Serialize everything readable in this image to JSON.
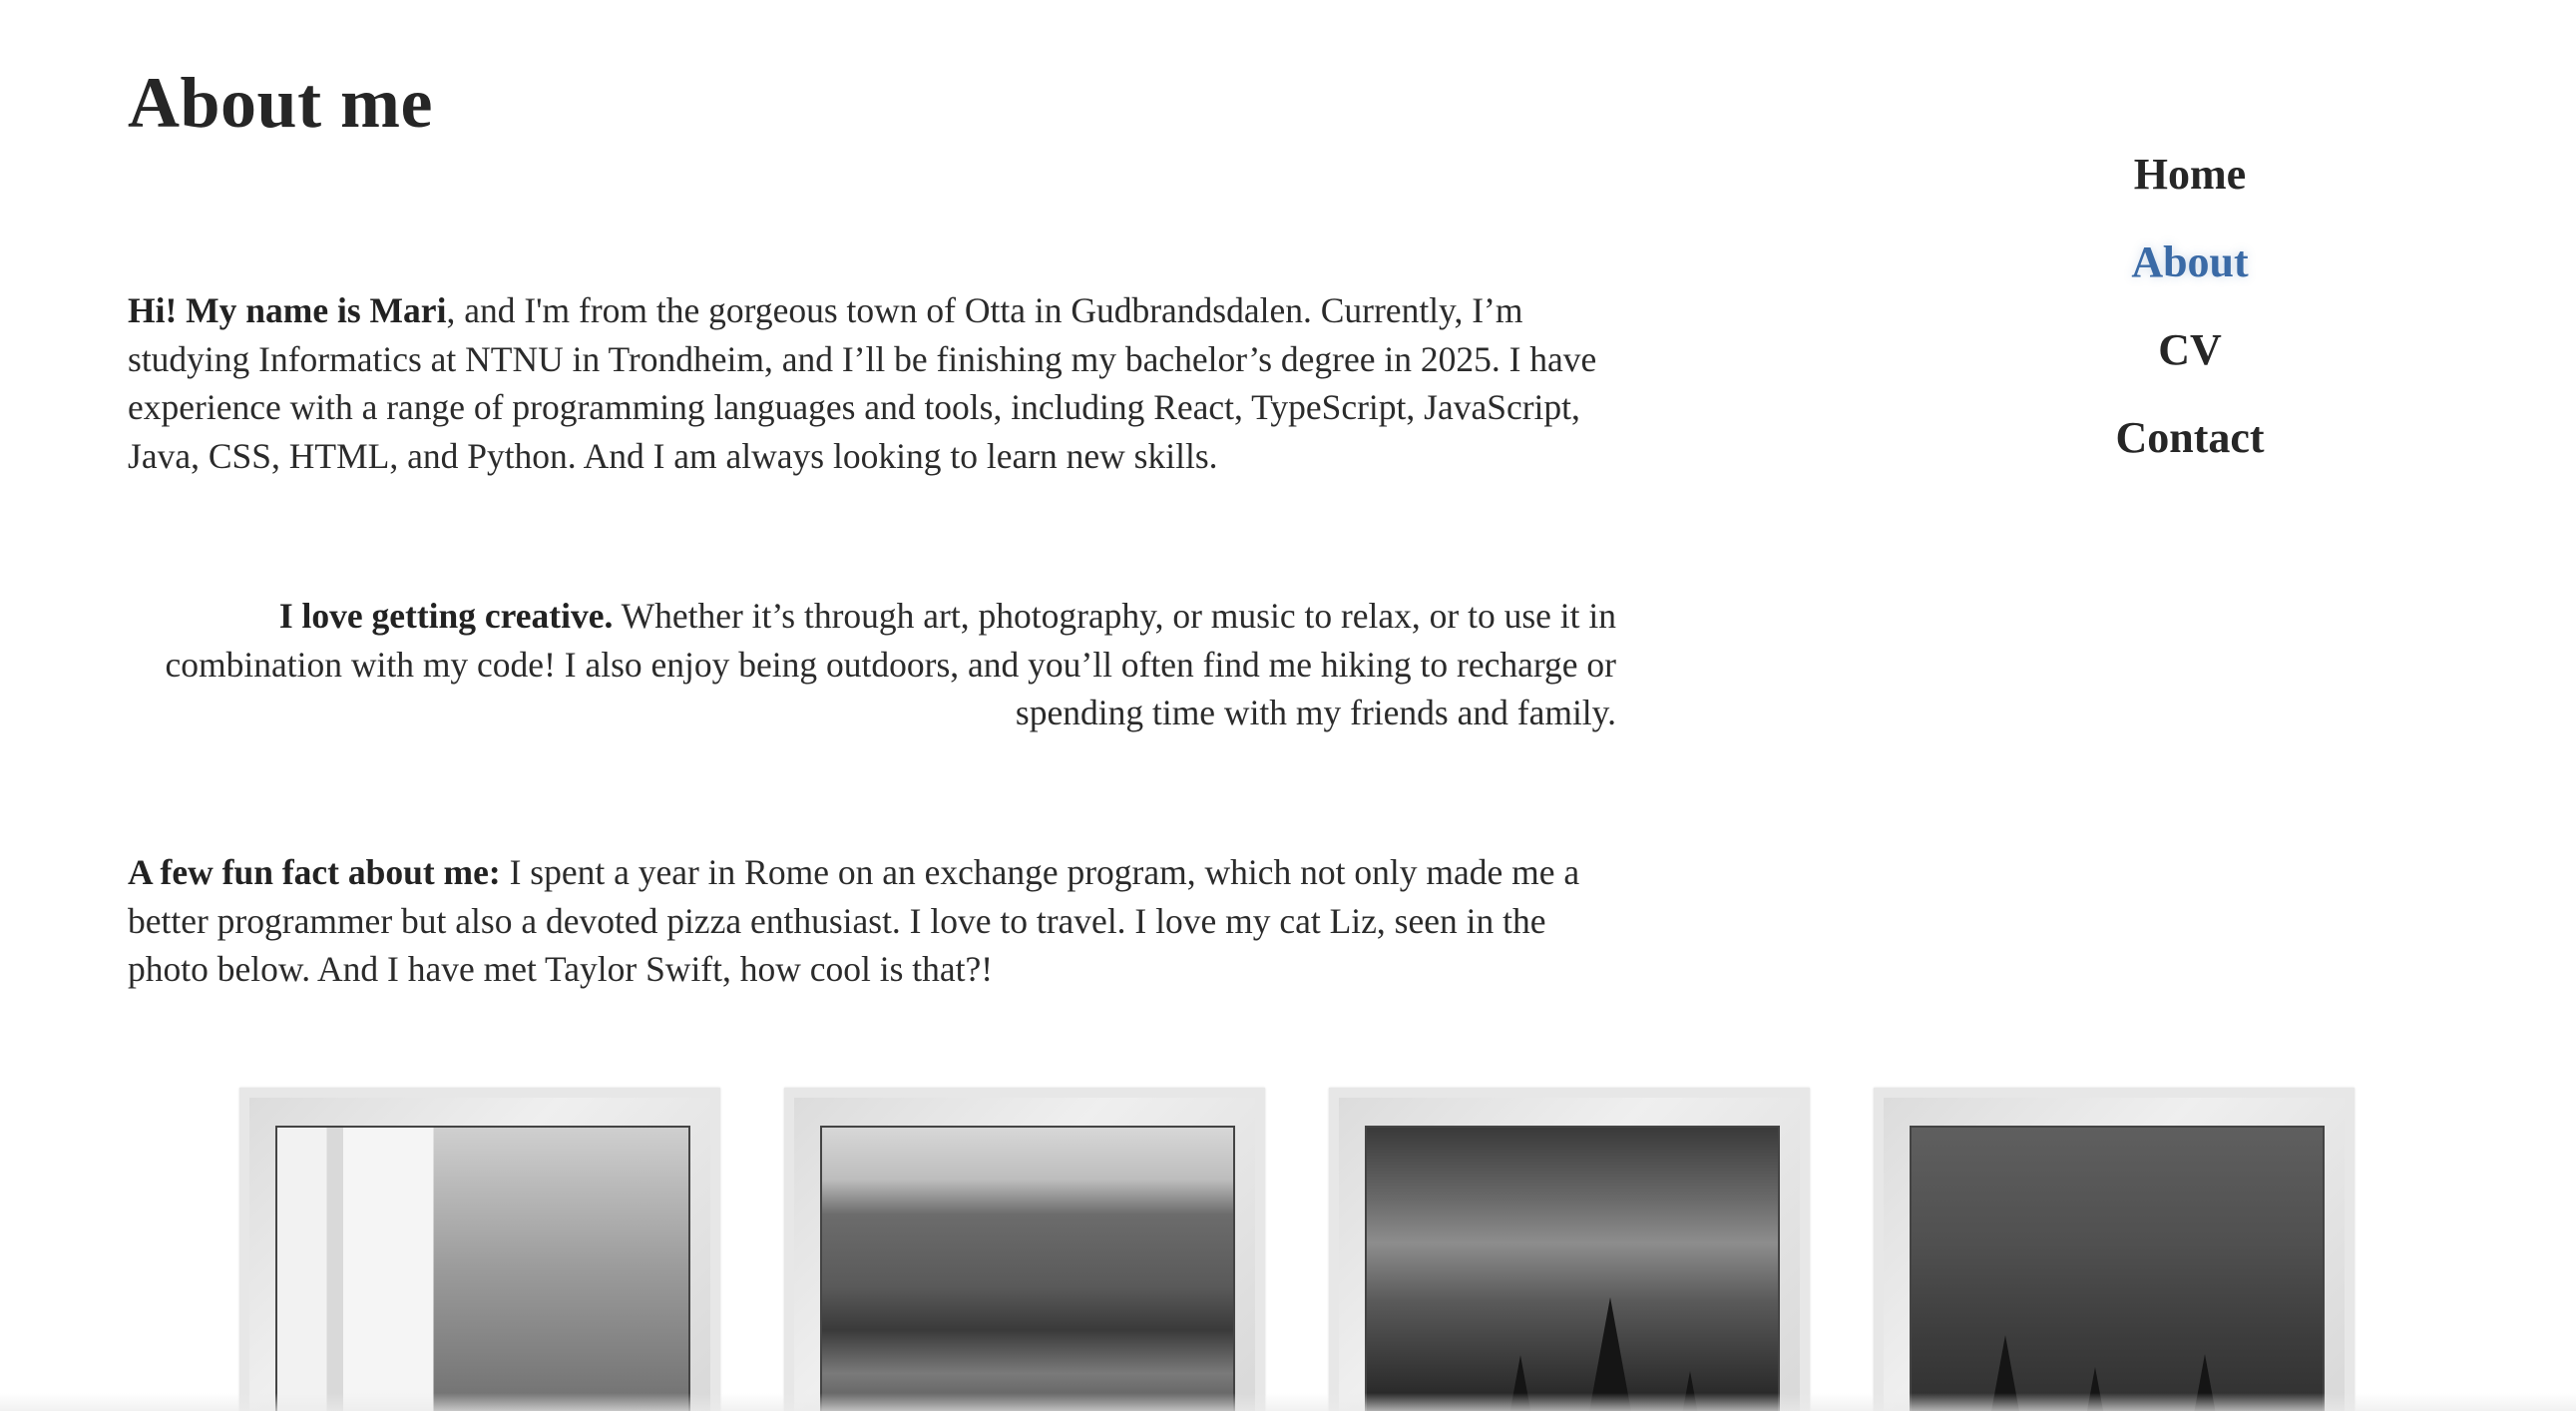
{
  "page": {
    "title": "About me"
  },
  "nav": {
    "items": [
      {
        "label": "Home",
        "active": false
      },
      {
        "label": "About",
        "active": true
      },
      {
        "label": "CV",
        "active": false
      },
      {
        "label": "Contact",
        "active": false
      }
    ]
  },
  "about": {
    "p1_bold": "Hi! My name is Mari",
    "p1_text": ", and I'm from the gorgeous town of Otta in Gudbrandsdalen. Currently, I’m studying Informatics at NTNU in Trondheim, and I’ll be finishing my bachelor’s degree in 2025. I have experience with a range of programming languages and tools, including React, TypeScript, JavaScript, Java, CSS, HTML, and Python. And I am always looking to learn new skills.",
    "p2_bold": "I love getting creative.",
    "p2_text": " Whether it’s through art, photography, or music to relax, or to use it in combination with my code! I also enjoy being outdoors, and you’ll often find me hiking to recharge or spending time with my friends and family.",
    "p3_bold": "A few fun fact about me:",
    "p3_text": " I spent a year in Rome on an exchange program, which not only made me a better programmer but also a devoted pizza enthusiast. I love to travel. I love my cat Liz, seen in the photo below. And I have met Taylor Swift, how cool is that?!"
  },
  "colors": {
    "text": "#2a2a2a",
    "active_nav": "#3a6aa6",
    "background": "#ffffff"
  }
}
